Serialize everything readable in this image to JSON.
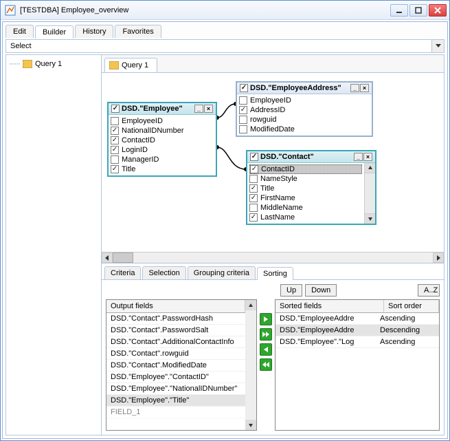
{
  "window": {
    "title": "[TESTDBA] Employee_overview"
  },
  "mainTabs": {
    "edit": "Edit",
    "builder": "Builder",
    "history": "History",
    "favorites": "Favorites"
  },
  "selectBar": {
    "label": "Select"
  },
  "tree": {
    "query1": "Query 1"
  },
  "innerTab": {
    "query1": "Query 1"
  },
  "tables": {
    "employee": {
      "title": "DSD.\"Employee\"",
      "fields": {
        "employeeId": "EmployeeID",
        "nationalId": "NationalIDNumber",
        "contactId": "ContactID",
        "loginId": "LoginID",
        "managerId": "ManagerID",
        "title": "Title"
      }
    },
    "employeeAddress": {
      "title": "DSD.\"EmployeeAddress\"",
      "fields": {
        "employeeId": "EmployeeID",
        "addressId": "AddressID",
        "rowguid": "rowguid",
        "modifiedDate": "ModifiedDate"
      }
    },
    "contact": {
      "title": "DSD.\"Contact\"",
      "fields": {
        "contactId": "ContactID",
        "nameStyle": "NameStyle",
        "title": "Title",
        "firstName": "FirstName",
        "middleName": "MiddleName",
        "lastName": "LastName"
      }
    }
  },
  "subTabs": {
    "criteria": "Criteria",
    "selection": "Selection",
    "grouping": "Grouping criteria",
    "sorting": "Sorting"
  },
  "sortButtons": {
    "up": "Up",
    "down": "Down",
    "az": "A..Z"
  },
  "outputFields": {
    "header": "Output fields",
    "rows": {
      "r0": "DSD.\"Contact\".PasswordHash",
      "r1": "DSD.\"Contact\".PasswordSalt",
      "r2": "DSD.\"Contact\".AdditionalContactInfo",
      "r3": "DSD.\"Contact\".rowguid",
      "r4": "DSD.\"Contact\".ModifiedDate",
      "r5": "DSD.\"Employee\".\"ContactID\"",
      "r6": "DSD.\"Employee\".\"NationalIDNumber\"",
      "r7": "DSD.\"Employee\".\"Title\"",
      "r8": "FIELD_1"
    }
  },
  "sortedFields": {
    "headerField": "Sorted fields",
    "headerOrder": "Sort order",
    "rows": {
      "r0f": "DSD.\"EmployeeAddre",
      "r0o": "Ascending",
      "r1f": "DSD.\"EmployeeAddre",
      "r1o": "Descending",
      "r2f": "DSD.\"Employee\".\"Log",
      "r2o": "Ascending"
    }
  }
}
